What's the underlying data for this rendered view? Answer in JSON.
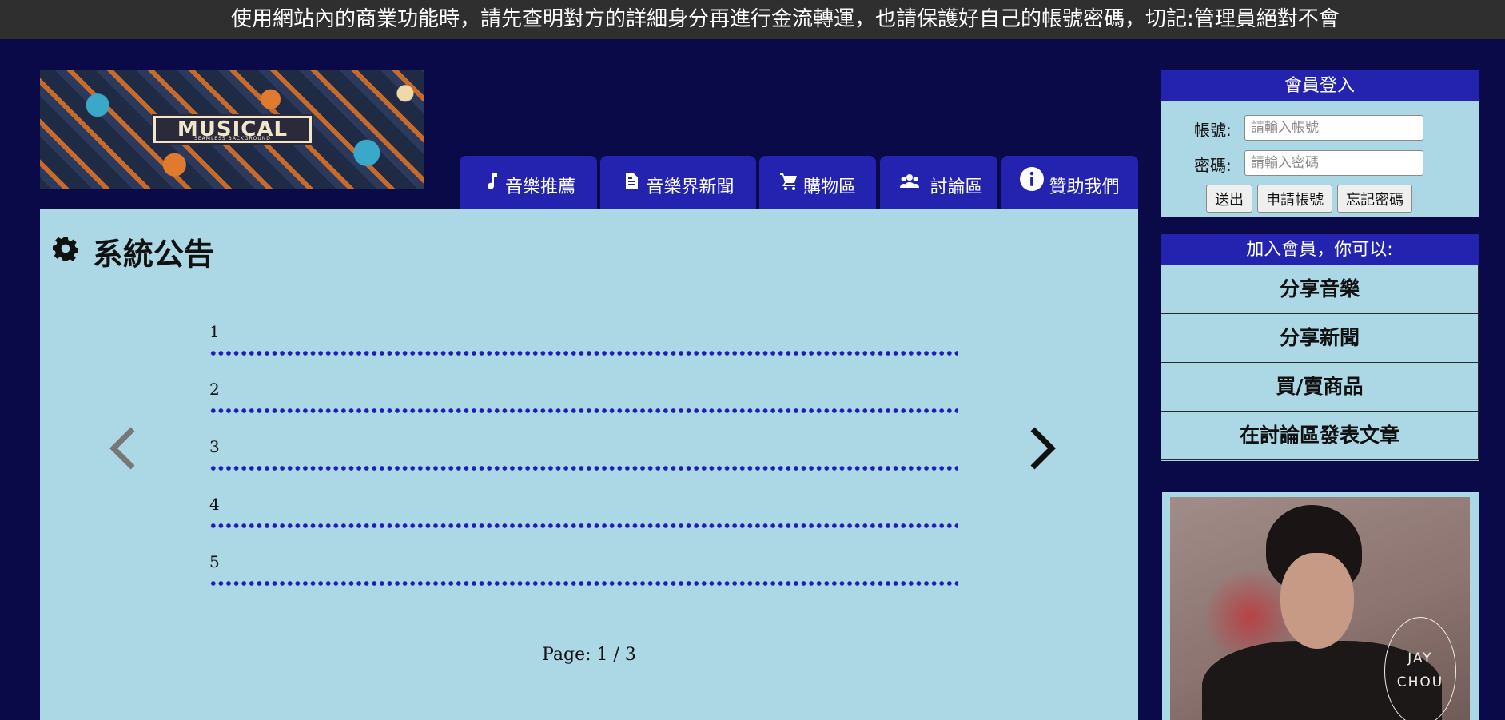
{
  "announcement_bar": {
    "text": "使用網站內的商業功能時，請先查明對方的詳細身分再進行金流轉運，也請保護好自己的帳號密碼，切記:管理員絕對不會"
  },
  "banner": {
    "logo_text": "MUSICAL",
    "logo_subtext": "SEAMLESS BACKGROUND"
  },
  "nav": {
    "tabs": [
      {
        "label": "音樂推薦",
        "icon": "music-note-icon"
      },
      {
        "label": "音樂界新聞",
        "icon": "document-icon"
      },
      {
        "label": "購物區",
        "icon": "shopping-cart-icon"
      },
      {
        "label": "討論區",
        "icon": "users-icon"
      },
      {
        "label": "贊助我們",
        "icon": "info-circle-icon"
      }
    ]
  },
  "main": {
    "title": "系統公告",
    "title_icon": "gear-icon",
    "items": [
      "1",
      "2",
      "3",
      "4",
      "5"
    ],
    "prev_icon": "chevron-left-icon",
    "next_icon": "chevron-right-icon",
    "page_indicator": "Page: 1 / 3"
  },
  "login": {
    "header": "會員登入",
    "username_label": "帳號:",
    "username_placeholder": "請輸入帳號",
    "password_label": "密碼:",
    "password_placeholder": "請輸入密碼",
    "submit_label": "送出",
    "register_label": "申請帳號",
    "forgot_label": "忘記密碼"
  },
  "join": {
    "header": "加入會員，你可以:",
    "items": [
      "分享音樂",
      "分享新聞",
      "買/賣商品",
      "在討論區發表文章"
    ]
  },
  "featured": {
    "photo_caption": "JAY CHOU"
  },
  "colors": {
    "page_background": "#0b0a48",
    "accent_blue": "#2323b0",
    "panel_lightblue": "#acd7e5",
    "top_bar": "#2f2f2f"
  }
}
